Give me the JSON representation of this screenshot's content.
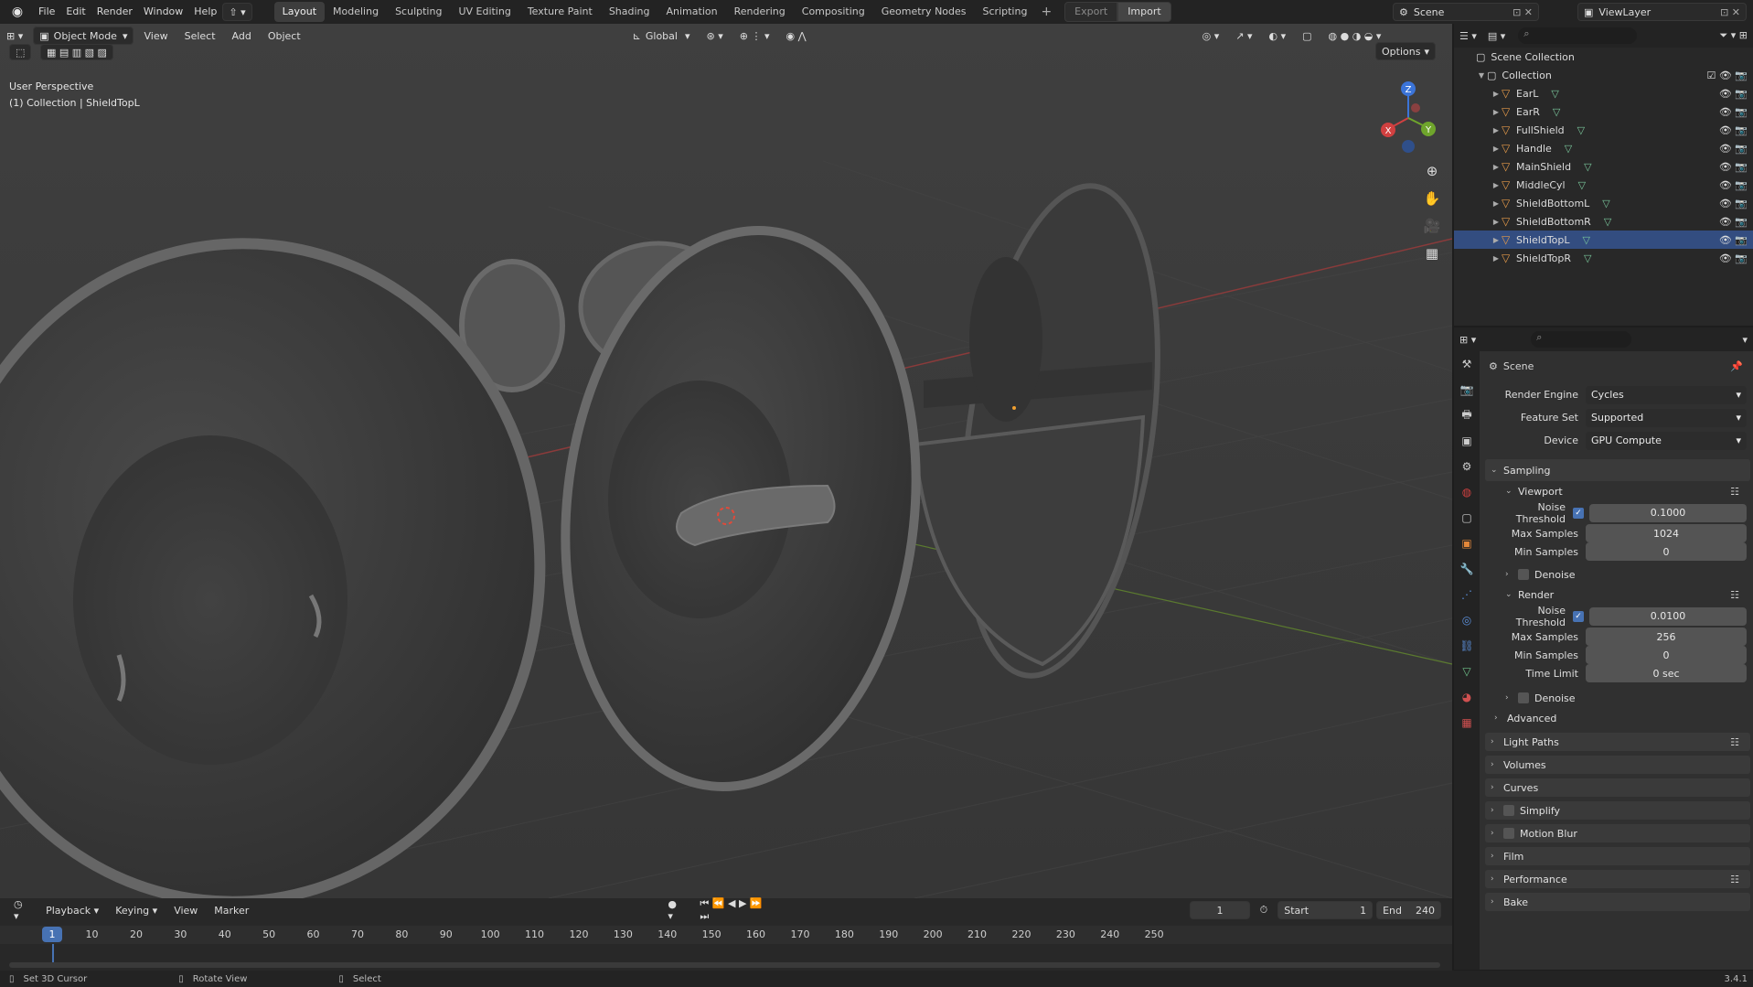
{
  "topbar": {
    "menus": [
      "File",
      "Edit",
      "Render",
      "Window",
      "Help"
    ],
    "workspaces": [
      "Layout",
      "Modeling",
      "Sculpting",
      "UV Editing",
      "Texture Paint",
      "Shading",
      "Animation",
      "Rendering",
      "Compositing",
      "Geometry Nodes",
      "Scripting"
    ],
    "export_label": "Export",
    "import_label": "Import",
    "scene": "Scene",
    "view_layer": "ViewLayer"
  },
  "viewport": {
    "mode": "Object Mode",
    "menus": [
      "View",
      "Select",
      "Add",
      "Object"
    ],
    "orientation": "Global",
    "options_label": "Options",
    "perspective_text": "User Perspective",
    "collection_text": "(1) Collection | ShieldTopL",
    "gizmo_axes": [
      "X",
      "Y",
      "Z"
    ]
  },
  "outliner": {
    "root": "Scene Collection",
    "collection": "Collection",
    "objects": [
      "EarL",
      "EarR",
      "FullShield",
      "Handle",
      "MainShield",
      "MiddleCyl",
      "ShieldBottomL",
      "ShieldBottomR",
      "ShieldTopL",
      "ShieldTopR"
    ],
    "selected": "ShieldTopL"
  },
  "properties": {
    "context": "Scene",
    "render_engine_label": "Render Engine",
    "render_engine": "Cycles",
    "feature_set_label": "Feature Set",
    "feature_set": "Supported",
    "device_label": "Device",
    "device": "GPU Compute",
    "sampling": "Sampling",
    "viewport_panel": "Viewport",
    "render_panel": "Render",
    "noise_threshold_label": "Noise Threshold",
    "viewport_noise": "0.1000",
    "render_noise": "0.0100",
    "max_samples_label": "Max Samples",
    "viewport_max": "1024",
    "render_max": "256",
    "min_samples_label": "Min Samples",
    "viewport_min": "0",
    "render_min": "0",
    "time_limit_label": "Time Limit",
    "time_limit": "0 sec",
    "denoise": "Denoise",
    "advanced": "Advanced",
    "sections": [
      "Light Paths",
      "Volumes",
      "Curves",
      "Simplify",
      "Motion Blur",
      "Film",
      "Performance",
      "Bake"
    ]
  },
  "timeline": {
    "menus": [
      "Playback",
      "Keying",
      "View",
      "Marker"
    ],
    "current_frame": "1",
    "start_label": "Start",
    "start": "1",
    "end_label": "End",
    "end": "240",
    "ruler": [
      "1",
      "10",
      "20",
      "30",
      "40",
      "50",
      "60",
      "70",
      "80",
      "90",
      "100",
      "110",
      "120",
      "130",
      "140",
      "150",
      "160",
      "170",
      "180",
      "190",
      "200",
      "210",
      "220",
      "230",
      "240",
      "250"
    ]
  },
  "status": {
    "set_cursor": "Set 3D Cursor",
    "rotate_view": "Rotate View",
    "select": "Select",
    "version": "3.4.1"
  }
}
